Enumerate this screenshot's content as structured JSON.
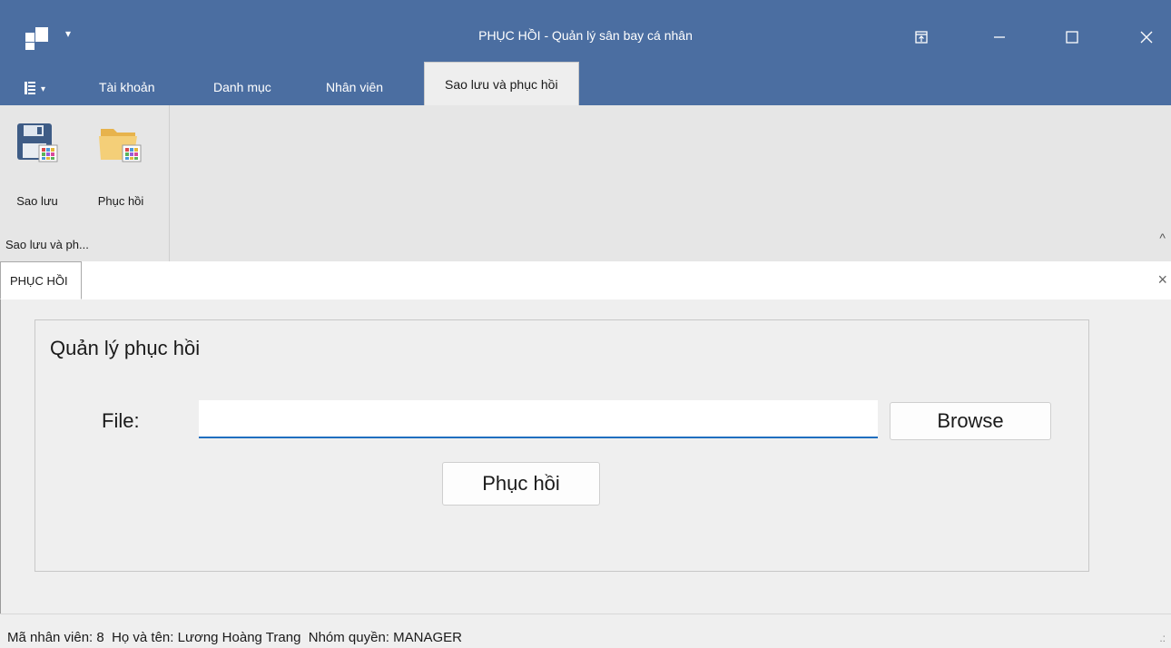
{
  "window": {
    "title": "PHỤC HỒI - Quản lý sân bay cá nhân"
  },
  "ribbon": {
    "tabs": [
      "Tài khoản",
      "Danh mục",
      "Nhân viên",
      "Sao lưu và phục hồi"
    ],
    "active_tab": "Sao lưu và phục hồi",
    "buttons": {
      "backup_label": "Sao lưu",
      "restore_label": "Phục hồi"
    },
    "group_label": "Sao lưu và ph..."
  },
  "document_tab": {
    "label": "PHỤC HỒI"
  },
  "restore_panel": {
    "title": "Quản lý phục hồi",
    "file_label": "File:",
    "file_value": "",
    "browse_label": "Browse",
    "restore_label": "Phục hồi"
  },
  "status_bar": {
    "text": "Mã nhân viên: 8  Họ và tên: Lương Hoàng Trang  Nhóm quyền: MANAGER"
  },
  "colors": {
    "titlebar": "#4b6ea1",
    "ribbon": "#e6e6e6",
    "input_underline": "#1f6fbf"
  },
  "icons": [
    "app-icon",
    "quick-access-dropdown-icon",
    "ribbon-display-options-icon",
    "minimize-icon",
    "maximize-icon",
    "close-icon",
    "file-menu-icon",
    "save-disk-icon",
    "folder-restore-icon",
    "collapse-ribbon-icon",
    "close-tab-icon",
    "size-grip-icon"
  ]
}
